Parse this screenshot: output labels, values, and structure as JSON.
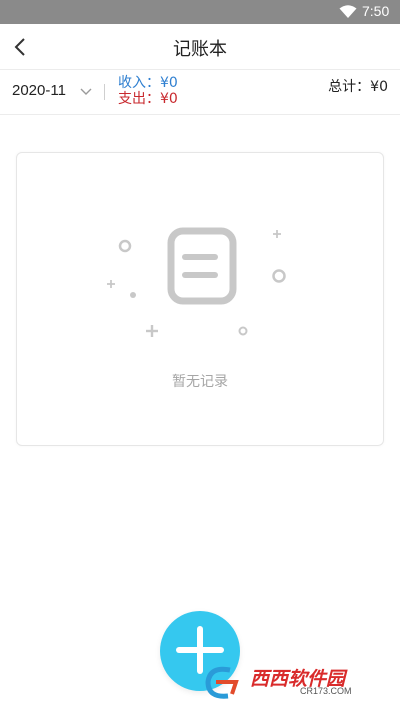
{
  "status_bar": {
    "time": "7:50",
    "icons": [
      "wifi-icon"
    ]
  },
  "header": {
    "title": "记账本",
    "back_icon": "chevron-left-icon"
  },
  "summary": {
    "month": "2020-11",
    "income": "收入：¥0",
    "expense": "支出：¥0",
    "total": "总计：¥0"
  },
  "empty_state": {
    "message": "暂无记录",
    "icon": "empty-records-icon"
  },
  "fab": {
    "icon": "plus-icon"
  },
  "watermark": {
    "text": "西西软件园",
    "sub": "CR173.COM"
  },
  "colors": {
    "status_bar": "#8a8a8a",
    "income": "#2f7fd0",
    "expense": "#c8282d",
    "fab": "#35c8ef",
    "empty_text": "#a6a6a6"
  }
}
